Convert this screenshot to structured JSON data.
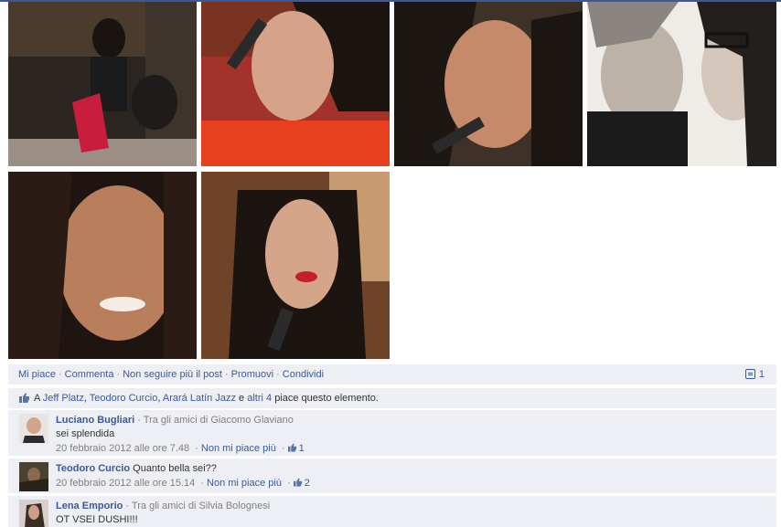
{
  "actions": {
    "like": "Mi piace",
    "comment": "Commenta",
    "unfollow": "Non seguire più il post",
    "promote": "Promuovi",
    "share": "Condividi",
    "comment_count": "1",
    "separator": "·"
  },
  "likes": {
    "prefix": "A",
    "user1": "Jeff Platz",
    "sep1": ",",
    "user2": "Teodoro Curcio",
    "sep2": ",",
    "user3": "Arará Latín Jazz",
    "and": "e",
    "others": "altri 4",
    "suffix": "piace questo elemento."
  },
  "comments": [
    {
      "name": "Luciano Bugliari",
      "via": "· Tra gli amici di Giacomo Glaviano",
      "text": "sei splendida",
      "time": "20 febbraio 2012 alle ore 7.48",
      "unlike": "Non mi piace più",
      "like_count": "1"
    },
    {
      "name": "Teodoro Curcio",
      "text": "Quanto bella sei??",
      "time": "20 febbraio 2012 alle ore 15.14",
      "unlike": "Non mi piace più",
      "like_count": "2"
    },
    {
      "name": "Lena Emporio",
      "via": "· Tra gli amici di Silvia Bolognesi",
      "text": "OT VSEI DUSHI!!!"
    }
  ],
  "icons": {
    "thumb": "thumbs-up-icon",
    "comment_count": "comment-icon"
  },
  "colors": {
    "link": "#3b5998",
    "panel_bg": "#edeff4",
    "muted": "#808080"
  }
}
